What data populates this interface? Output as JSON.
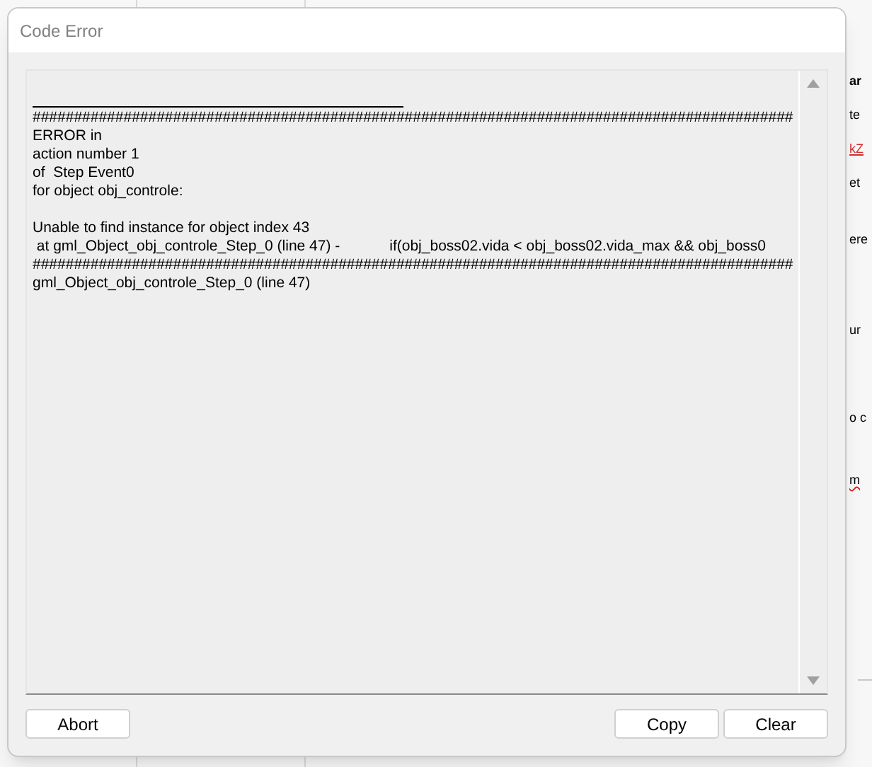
{
  "background_window": {
    "fragments": [
      {
        "text": "ar",
        "kind": "bold"
      },
      {
        "text": "te",
        "kind": "plain"
      },
      {
        "text": "kZ",
        "kind": "link"
      },
      {
        "text": "et",
        "kind": "plain"
      },
      {
        "text": "ere",
        "kind": "plain"
      },
      {
        "text": "ur",
        "kind": "plain"
      },
      {
        "text": "o c",
        "kind": "plain"
      },
      {
        "text": "m",
        "kind": "misspelled"
      }
    ]
  },
  "dialog": {
    "title": "Code Error",
    "log_blocks": [
      [
        "############################################################################################",
        "ERROR in",
        "action number 1",
        "of  Step Event0",
        "for object obj_controle:"
      ],
      [
        "Unable to find instance for object index 43",
        " at gml_Object_obj_controle_Step_0 (line 47) -            if(obj_boss02.vida < obj_boss02.vida_max && obj_boss0",
        "############################################################################################",
        "gml_Object_obj_controle_Step_0 (line 47)"
      ]
    ],
    "buttons_left": [
      "Abort"
    ],
    "buttons_right": [
      "Copy",
      "Clear"
    ]
  }
}
